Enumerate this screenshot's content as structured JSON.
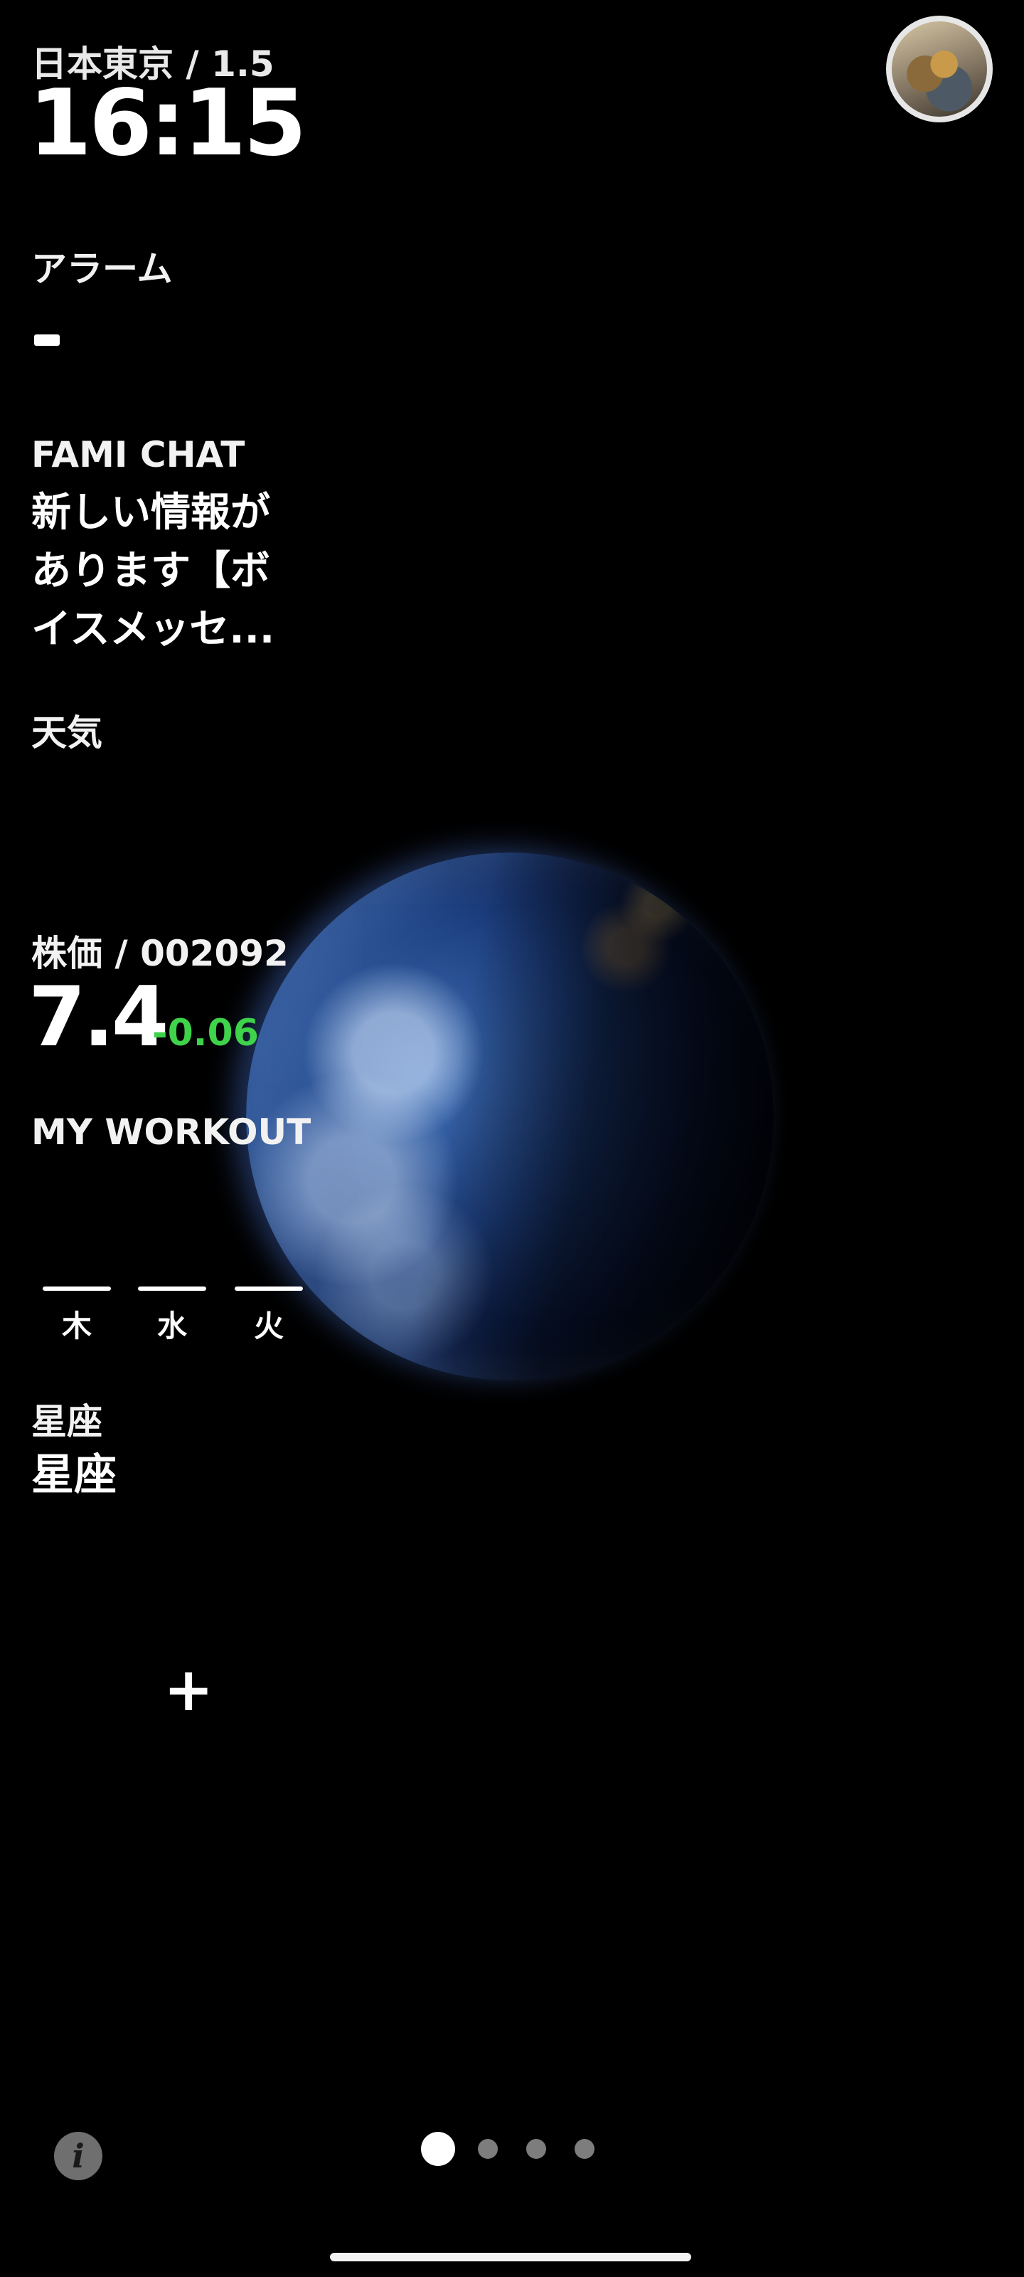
{
  "header": {
    "location": "日本東京 / 1.5",
    "time": "16:15"
  },
  "alarm": {
    "label": "アラーム",
    "value": "-"
  },
  "chat": {
    "label": "FAMI CHAT",
    "message_lines": [
      "新しい情報が",
      "あります【ボ",
      "イスメッセ..."
    ]
  },
  "weather": {
    "label": "天気"
  },
  "stock": {
    "label": "株価 / 002092",
    "price": "7.4",
    "change": "-0.06",
    "change_color": "#3fd24b"
  },
  "workout": {
    "label": "MY WORKOUT",
    "days": [
      "木",
      "水",
      "火"
    ]
  },
  "zodiac": {
    "label": "星座",
    "value": "星座"
  },
  "add": {
    "symbol": "+"
  },
  "footer": {
    "info_symbol": "i",
    "pages": 4,
    "active_page": 1
  }
}
